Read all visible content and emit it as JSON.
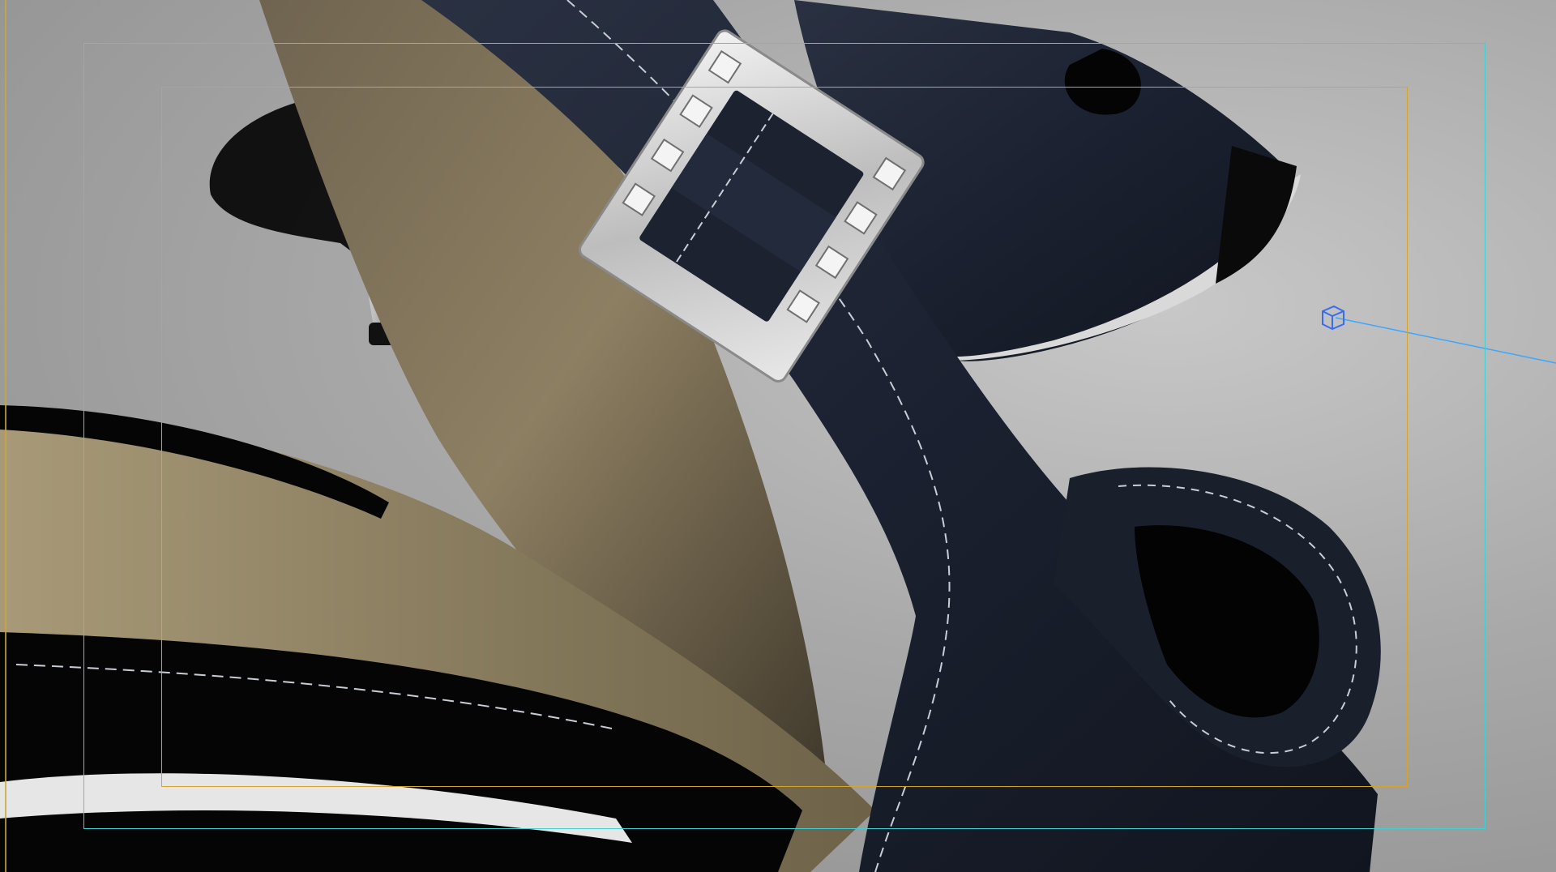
{
  "viewport": {
    "colors": {
      "background": "#a9a9a9",
      "strap_dark": "#1c2230",
      "strap_edge": "#0d1119",
      "lining": "#8a7d60",
      "lining_dark": "#4a4232",
      "patent_black": "#050505",
      "buckle_silver": "#d8d8d8",
      "stitching": "#c9cdd6",
      "action_safe_frame": "#3fd0d6",
      "title_safe_frame": "#d6a528",
      "light_gizmo": "#3a6cf0"
    },
    "icons": {
      "light_gizmo": "cube-icon"
    }
  }
}
